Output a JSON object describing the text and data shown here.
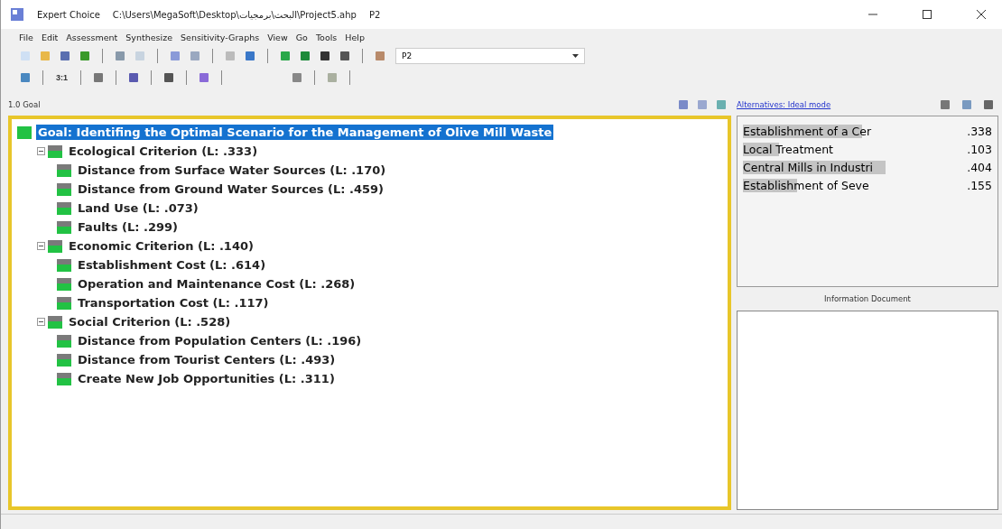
{
  "window": {
    "app": "Expert Choice",
    "path": "C:\\Users\\MegaSoft\\Desktop\\البحث\\برمجيات\\Project5.ahp",
    "model": "P2"
  },
  "menu": [
    "File",
    "Edit",
    "Assessment",
    "Synthesize",
    "Sensitivity-Graphs",
    "View",
    "Go",
    "Tools",
    "Help"
  ],
  "toolbar": {
    "combo_value": "P2",
    "ratio_label": "3:1"
  },
  "node_path": "1.0 Goal",
  "tree": {
    "label": "Goal: Identifing the Optimal Scenario for the Management of Olive Mill Waste",
    "selected": true,
    "children": [
      {
        "label": "Ecological Criterion (L: .333)",
        "expanded": true,
        "children": [
          {
            "label": "Distance from Surface Water Sources (L: .170)"
          },
          {
            "label": "Distance from Ground Water Sources (L: .459)"
          },
          {
            "label": "Land Use (L: .073)"
          },
          {
            "label": "Faults (L: .299)"
          }
        ]
      },
      {
        "label": "Economic Criterion (L: .140)",
        "expanded": true,
        "children": [
          {
            "label": "Establishment Cost (L: .614)"
          },
          {
            "label": "Operation and Maintenance Cost (L: .268)"
          },
          {
            "label": "Transportation Cost (L: .117)"
          }
        ]
      },
      {
        "label": "Social Criterion (L: .528)",
        "expanded": true,
        "children": [
          {
            "label": "Distance from Population Centers (L: .196)"
          },
          {
            "label": "Distance from Tourist Centers (L: .493)"
          },
          {
            "label": "Create New Job Opportunities (L: .311)"
          }
        ]
      }
    ]
  },
  "alternatives": {
    "link": "Alternatives: Ideal mode",
    "items": [
      {
        "name": "Establishment of a Cer",
        "value": ".338"
      },
      {
        "name": "Local Treatment",
        "value": ".103"
      },
      {
        "name": "Central Mills in Industri",
        "value": ".404"
      },
      {
        "name": "Establishment of Seve",
        "value": ".155"
      }
    ]
  },
  "info_title": "Information Document"
}
